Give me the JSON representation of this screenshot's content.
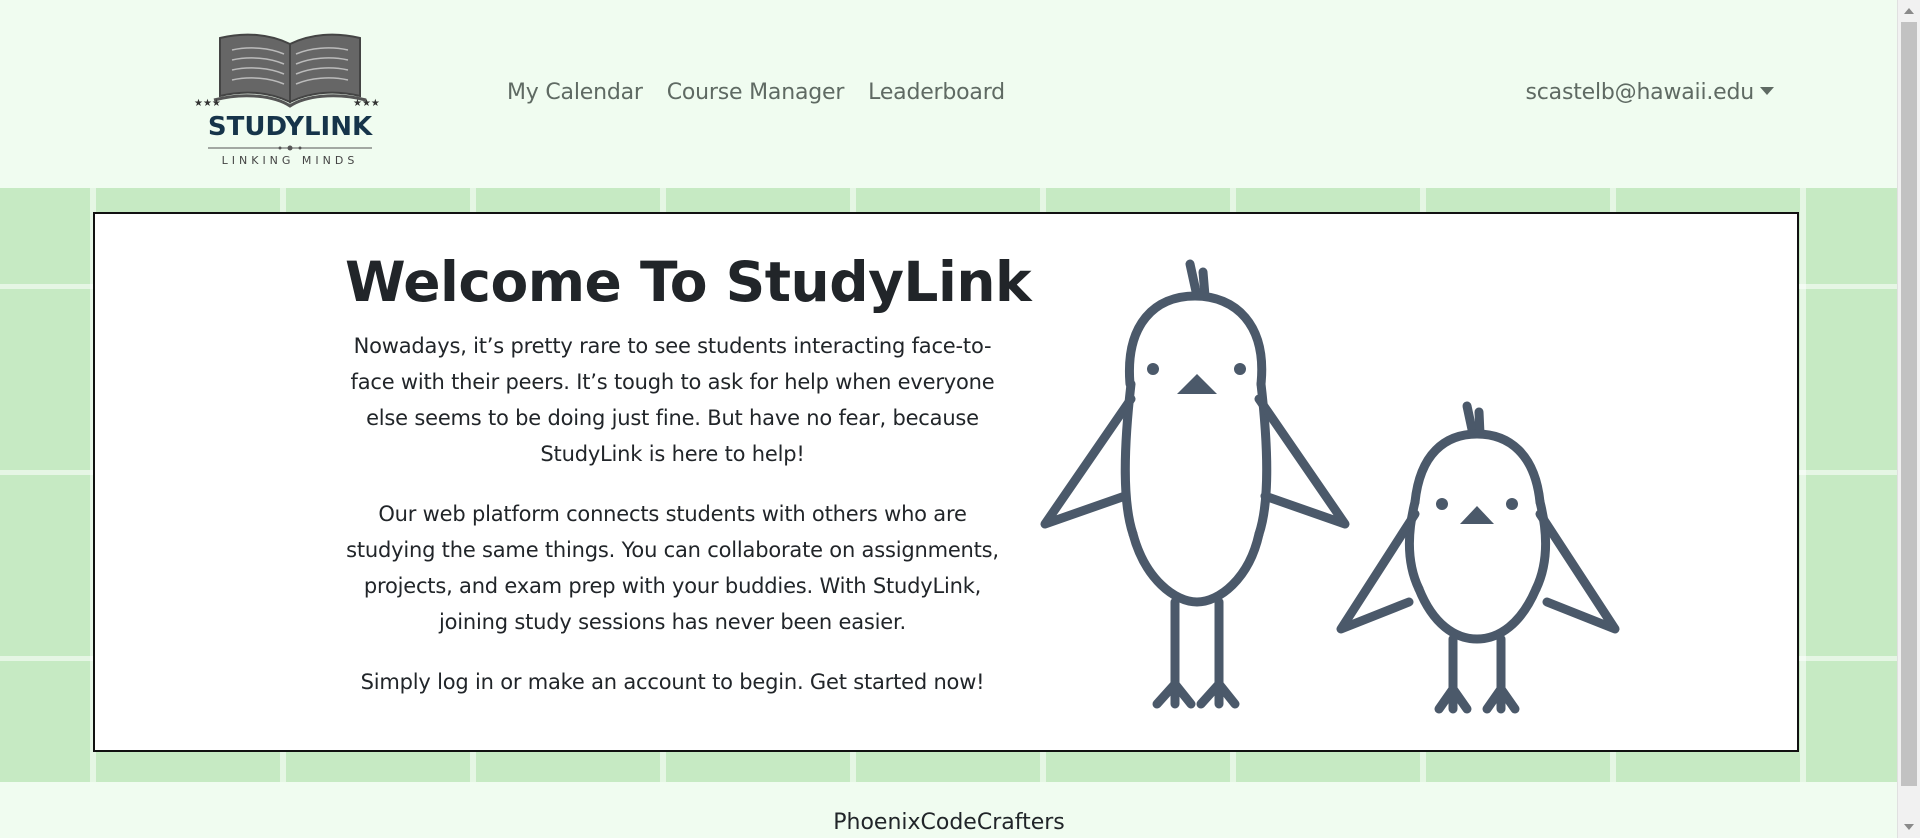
{
  "header": {
    "logo": {
      "wordmark": "STUDYLINK",
      "tagline": "LINKING MINDS",
      "icon": "open-book-icon"
    },
    "nav": [
      {
        "label": "My Calendar"
      },
      {
        "label": "Course Manager"
      },
      {
        "label": "Leaderboard"
      }
    ],
    "user": {
      "email": "scastelb@hawaii.edu",
      "icon": "chevron-down-icon"
    }
  },
  "hero": {
    "title": "Welcome To StudyLink",
    "paragraphs": [
      "Nowadays, it’s pretty rare to see students interacting face-to-face with their peers. It’s tough to ask for help when everyone else seems to be doing just fine. But have no fear, because StudyLink is here to help!",
      "Our web platform connects students with others who are studying the same things. You can collaborate on assignments, projects, and exam prep with your buddies. With StudyLink, joining study sessions has never been easier.",
      "Simply log in or make an account to begin. Get started now!"
    ],
    "illustration": "two-birds-illustration"
  },
  "footer": {
    "text": "PhoenixCodeCrafters"
  },
  "colors": {
    "page_background": "#f0fcf0",
    "hero_tile": "#c6eac3",
    "bird_stroke": "#4b596a",
    "logo_ink": "#555555",
    "logo_wordmark": "#16344a"
  }
}
